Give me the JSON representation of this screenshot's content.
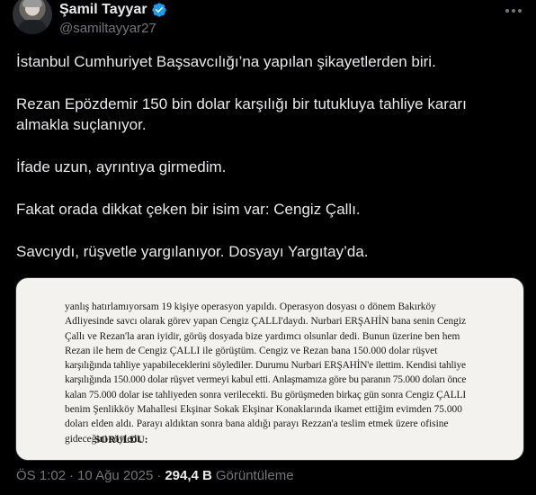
{
  "author": {
    "name": "Şamil Tayyar",
    "handle": "@samiltayyar27"
  },
  "tweet": {
    "paragraphs": [
      "İstanbul Cumhuriyet Başsavcılığı’na yapılan şikayetlerden biri.",
      "Rezan Epözdemir 150 bin dolar karşılığı bir tutukluya tahliye kararı almakla suçlanıyor.",
      "İfade uzun, ayrıntıya girmedim.",
      "Fakat orada dikkat çeken bir isim var: Cengiz Çallı.",
      "Savcıydı, rüşvetle yargılanıyor. Dosyayı Yargıtay’da."
    ]
  },
  "document": {
    "lines": [
      "yanlış hatırlamıyorsam 19 kişiye operasyon yapıldı. Operasyon dosyası o dönem Bakırköy",
      "Adliyesinde savcı olarak görev yapan Cengiz ÇALLI'daydı. Nurbari ERŞAHİN bana senin Cengiz",
      "Çallı ve Rezan'la aran iyidir, görüş dosyada bize yardımcı olsunlar dedi. Bunun üzerine ben hem",
      "Rezan ile hem de Cengiz ÇALLI ile görüştüm. Cengiz ve Rezan bana 150.000 dolar rüşvet",
      "karşılığında tahliye yapabileceklerini söylediler. Durumu Nurbari ERŞAHİN'e ilettim. Kendisi tahliye",
      "karşılığında 150.000 dolar rüşvet vermeyi kabul etti. Anlaşmamıza göre bu paranın 75.000 doları önce",
      "kalan 75.000 dolar ise tahliyeden sonra verilecekti. Bu görüşmeden birkaç gün sonra Cengiz ÇALLI",
      "benim Şenlikköy Mahallesi Ekşinar Sokak Ekşinar Konaklarında ikamet ettiğim evimden 75.000",
      "doları elden aldı. Parayı aldıktan sonra bana aldığı parayı Rezzan'a teslim etmek üzere ofisine",
      "gideceğini söyledi."
    ],
    "heading": "SORULDU:"
  },
  "meta": {
    "time": "ÖS 1:02",
    "date": "10 Ağu 2025",
    "views": "294,4 B",
    "views_label": "Görüntüleme"
  },
  "colors": {
    "background": "#000000",
    "text": "#e7e9ea",
    "secondary": "#71767b",
    "verified": "#1d9bf0"
  }
}
